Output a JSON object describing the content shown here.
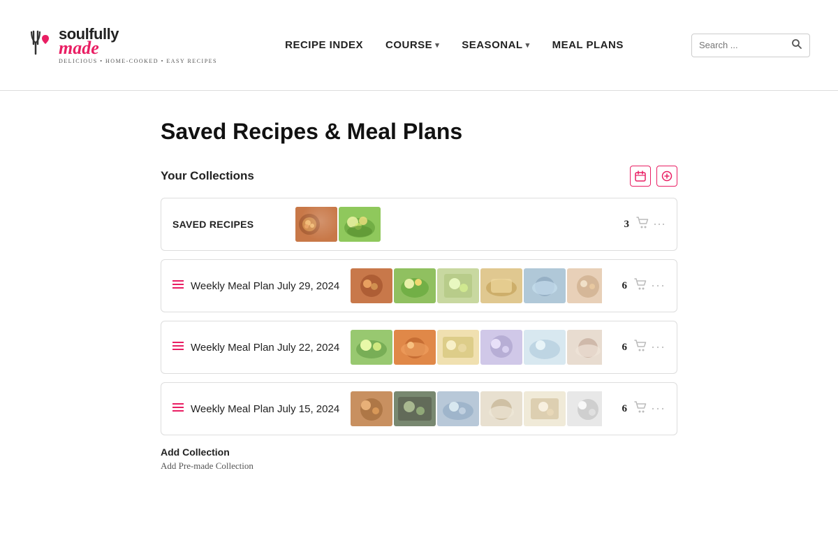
{
  "site": {
    "name_part1": "soulfully",
    "name_part2": "made",
    "tagline": "DELICIOUS • HOME-COOKED • EASY RECIPES"
  },
  "nav": {
    "items": [
      {
        "label": "RECIPE INDEX",
        "has_dropdown": false
      },
      {
        "label": "COURSE",
        "has_dropdown": true
      },
      {
        "label": "SEASONAL",
        "has_dropdown": true
      },
      {
        "label": "MEAL PLANS",
        "has_dropdown": false
      }
    ],
    "search_placeholder": "Search ..."
  },
  "page": {
    "title": "Saved Recipes & Meal Plans"
  },
  "collections": {
    "section_label": "Your Collections",
    "items": [
      {
        "id": "saved-recipes",
        "name": "SAVED RECIPES",
        "count": 3,
        "has_reorder": false
      },
      {
        "id": "meal-plan-july29",
        "name": "Weekly Meal Plan July 29, 2024",
        "count": 6,
        "has_reorder": true
      },
      {
        "id": "meal-plan-july22",
        "name": "Weekly Meal Plan July 22, 2024",
        "count": 6,
        "has_reorder": true
      },
      {
        "id": "meal-plan-july15",
        "name": "Weekly Meal Plan July 15, 2024",
        "count": 6,
        "has_reorder": true
      }
    ],
    "add_collection_label": "Add Collection",
    "add_premade_label": "Add Pre-made Collection"
  },
  "icons": {
    "calendar": "📅",
    "plus_circle": "⊕",
    "cart": "🛒",
    "more": "•••",
    "search": "🔍",
    "reorder": "≡",
    "fork_heart": "🍴"
  },
  "colors": {
    "accent": "#e91e63",
    "text_dark": "#222222",
    "text_muted": "#888888",
    "border": "#dddddd"
  }
}
